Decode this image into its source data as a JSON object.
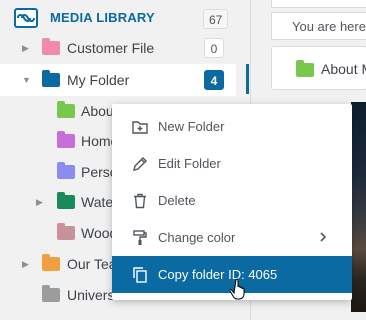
{
  "sidebar": {
    "title": "MEDIA LIBRARY",
    "total_count": "67",
    "items": [
      {
        "label": "Customer File",
        "color": "#f08ab0",
        "count": "0",
        "arrow": "▶"
      },
      {
        "label": "My Folder",
        "color": "#0a6aa1",
        "count": "4",
        "arrow": "▼"
      },
      {
        "label": "Abou",
        "color": "#78c850"
      },
      {
        "label": "Home",
        "color": "#c86ed8"
      },
      {
        "label": "Perso",
        "color": "#8c8cf0"
      },
      {
        "label": "Wate",
        "color": "#1a8a5a",
        "arrow": "▶"
      },
      {
        "label": "Wood",
        "color": "#c8929a"
      },
      {
        "label": "Our Tea",
        "color": "#f0a040",
        "arrow": "▶"
      },
      {
        "label": "Univers",
        "color": "#9c9c9c"
      }
    ]
  },
  "content": {
    "breadcrumb": "You are here",
    "folder_card_label": "About M",
    "folder_card_color": "#78c850"
  },
  "context_menu": {
    "items": [
      {
        "label": "New Folder",
        "icon": "new-folder-icon"
      },
      {
        "label": "Edit Folder",
        "icon": "pencil-icon"
      },
      {
        "label": "Delete",
        "icon": "trash-icon"
      },
      {
        "label": "Change color",
        "icon": "paint-roller-icon"
      },
      {
        "label": "Copy folder ID: 4065",
        "icon": "copy-icon"
      }
    ],
    "highlight_color": "#0a6aa1"
  }
}
